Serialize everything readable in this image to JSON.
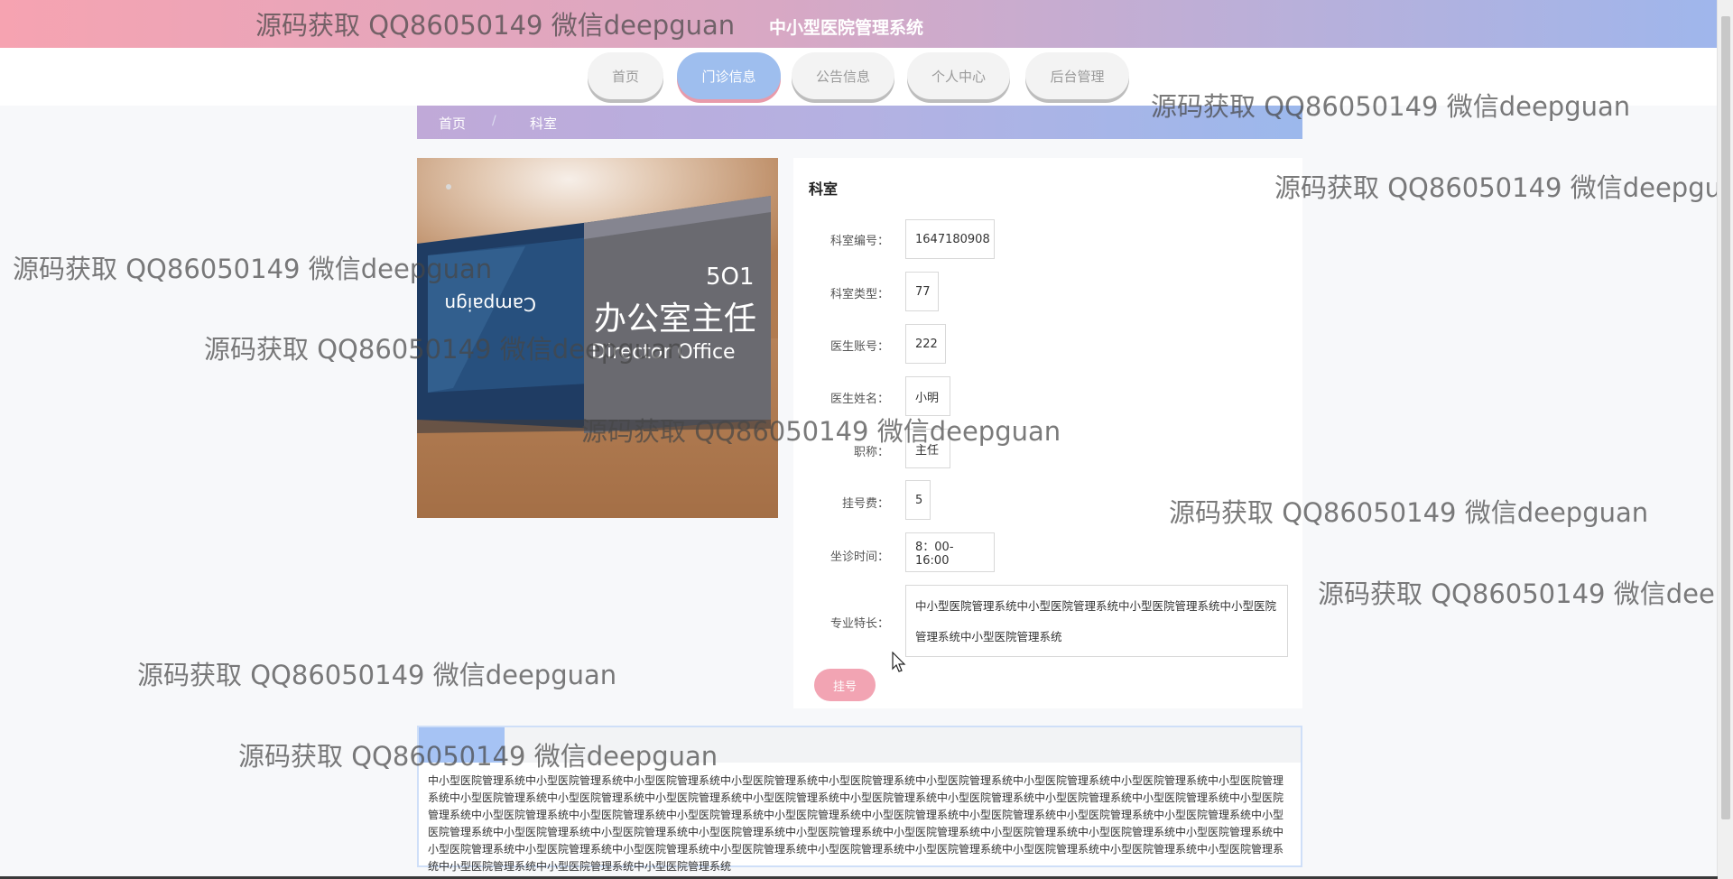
{
  "site": {
    "title": "中小型医院管理系统"
  },
  "nav": {
    "items": [
      {
        "label": "首页"
      },
      {
        "label": "门诊信息"
      },
      {
        "label": "公告信息"
      },
      {
        "label": "个人中心"
      },
      {
        "label": "后台管理"
      }
    ],
    "active_index": 1
  },
  "breadcrumb": {
    "home": "首页",
    "separator": "/",
    "current": "科室"
  },
  "photo": {
    "sign_number": "5O1",
    "sign_campaign": "Campaign",
    "sign_chinese": "办公室主任",
    "sign_english": "Director Office"
  },
  "detail": {
    "title": "科室",
    "fields": [
      {
        "label": "科室编号：",
        "value": "1647180908"
      },
      {
        "label": "科室类型：",
        "value": "77"
      },
      {
        "label": "医生账号：",
        "value": "222"
      },
      {
        "label": "医生姓名：",
        "value": "小明"
      },
      {
        "label": "职称：",
        "value": "主任"
      },
      {
        "label": "挂号费：",
        "value": "5"
      },
      {
        "label": "坐诊时间：",
        "value": "8：00-16:00"
      }
    ],
    "specialty": {
      "label": "专业特长：",
      "value": "中小型医院管理系统中小型医院管理系统中小型医院管理系统中小型医院管理系统中小型医院管理系统"
    },
    "register_button": "挂号"
  },
  "description": {
    "text": "中小型医院管理系统中小型医院管理系统中小型医院管理系统中小型医院管理系统中小型医院管理系统中小型医院管理系统中小型医院管理系统中小型医院管理系统中小型医院管理系统中小型医院管理系统中小型医院管理系统中小型医院管理系统中小型医院管理系统中小型医院管理系统中小型医院管理系统中小型医院管理系统中小型医院管理系统中小型医院管理系统中小型医院管理系统中小型医院管理系统中小型医院管理系统中小型医院管理系统中小型医院管理系统中小型医院管理系统中小型医院管理系统中小型医院管理系统中小型医院管理系统中小型医院管理系统中小型医院管理系统中小型医院管理系统中小型医院管理系统中小型医院管理系统中小型医院管理系统中小型医院管理系统中小型医院管理系统中小型医院管理系统中小型医院管理系统中小型医院管理系统中小型医院管理系统中小型医院管理系统中小型医院管理系统中小型医院管理系统中小型医院管理系统中小型医院管理系统中小型医院管理系统中小型医院管理系统中小型医院管理系统"
  },
  "watermark": {
    "text": "源码获取 QQ86050149 微信deepguan"
  },
  "colors": {
    "header_start": "#f6a3b1",
    "header_end": "#9fb6ec",
    "nav_active": "#9ebeee",
    "register_button": "#f2a4b3"
  }
}
